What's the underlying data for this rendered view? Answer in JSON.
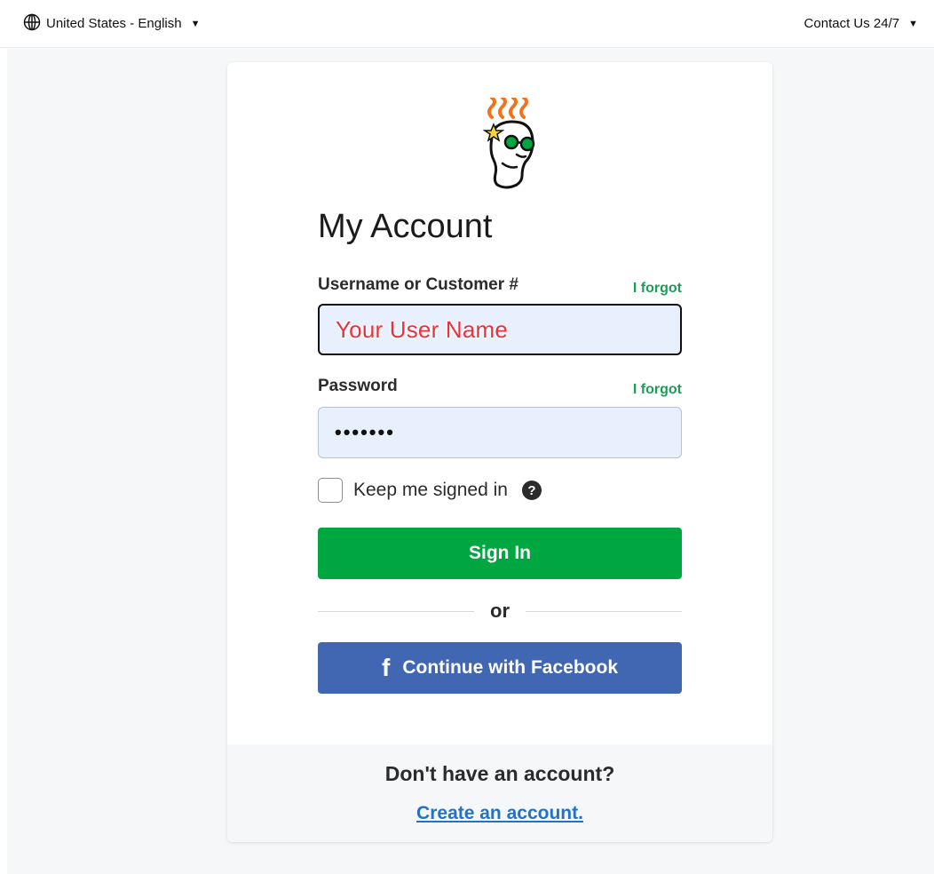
{
  "topbar": {
    "locale_label": "United States - English",
    "contact_label": "Contact Us 24/7"
  },
  "login": {
    "title": "My Account",
    "username": {
      "label": "Username or Customer #",
      "forgot": "I forgot",
      "value": "Your User Name"
    },
    "password": {
      "label": "Password",
      "forgot": "I forgot",
      "value": "•••••••"
    },
    "keep_signed_in": {
      "label": "Keep me signed in",
      "checked": false
    },
    "sign_in_button": "Sign In",
    "divider_text": "or",
    "facebook_button": "Continue with Facebook"
  },
  "footer": {
    "question": "Don't have an account?",
    "create_link": "Create an account."
  },
  "icons": {
    "locale": "globe-icon",
    "caret": "caret-down-icon",
    "help": "question-circle-icon",
    "facebook": "facebook-icon",
    "logo": "godaddy-guy-logo-icon"
  },
  "colors": {
    "primary_green": "#00a63f",
    "facebook_blue": "#4267b2",
    "forgot_green": "#1a9e55",
    "link_blue": "#2472c8",
    "input_fill": "#e8f0fe",
    "username_overlay_red": "#e8323c"
  }
}
